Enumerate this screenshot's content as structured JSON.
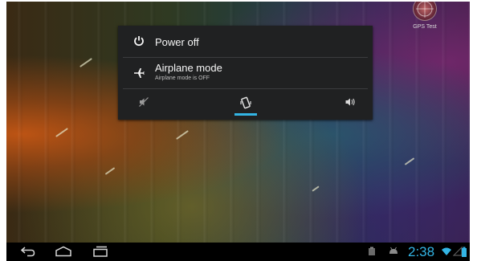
{
  "wallpaper": {
    "widget_label": "GPS Test"
  },
  "power_menu": {
    "items": [
      {
        "icon": "power-icon",
        "title": "Power off",
        "subtitle": ""
      },
      {
        "icon": "airplane-icon",
        "title": "Airplane mode",
        "subtitle": "Airplane mode is OFF"
      }
    ],
    "sound_modes": [
      {
        "icon": "silent-icon",
        "selected": false
      },
      {
        "icon": "vibrate-icon",
        "selected": true
      },
      {
        "icon": "sound-on-icon",
        "selected": false
      }
    ],
    "accent_color": "#33b5e5"
  },
  "navbar": {
    "buttons": [
      "back-icon",
      "home-icon",
      "recent-apps-icon"
    ]
  },
  "status": {
    "time": "2:38",
    "icons": [
      "notification-icon",
      "android-icon",
      "wifi-icon",
      "signal-icon",
      "battery-icon"
    ]
  }
}
